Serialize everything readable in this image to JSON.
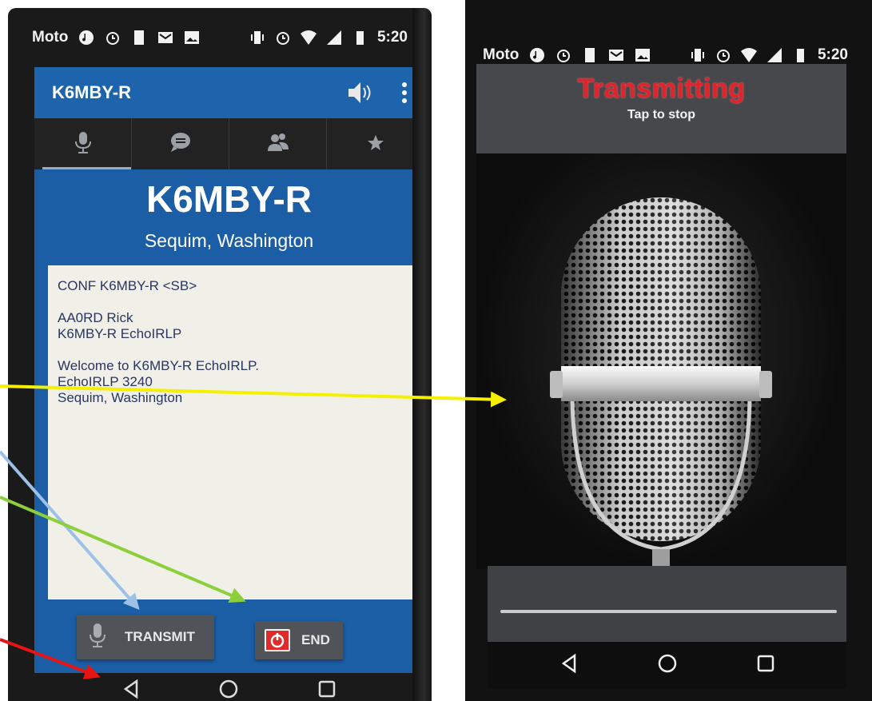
{
  "left_phone": {
    "status": {
      "carrier": "Moto",
      "time": "5:20"
    },
    "appbar": {
      "title": "K6MBY-R"
    },
    "tabs": [
      {
        "name": "microphone-icon",
        "active": true
      },
      {
        "name": "chat-icon",
        "active": false
      },
      {
        "name": "people-icon",
        "active": false
      },
      {
        "name": "star-icon",
        "active": false
      }
    ],
    "station": {
      "callsign": "K6MBY-R",
      "location": "Sequim, Washington"
    },
    "messages": [
      "CONF K6MBY-R <SB>",
      "",
      "AA0RD Rick",
      "K6MBY-R EchoIRLP",
      "",
      "Welcome to K6MBY-R EchoIRLP.",
      "EchoIRLP 3240",
      "Sequim, Washington"
    ],
    "buttons": {
      "transmit": "TRANSMIT",
      "end": "END"
    }
  },
  "right_phone": {
    "status": {
      "carrier": "Moto",
      "time": "5:20"
    },
    "transmitting": {
      "title": "Transmitting",
      "subtitle": "Tap to stop"
    }
  },
  "colors": {
    "appbar_blue": "#1d64ad",
    "content_blue": "#1b5ea6",
    "transmit_red": "#e0242c",
    "arrow_yellow": "#f5f000",
    "arrow_light_blue": "#9cc0e6",
    "arrow_green": "#8ccf3a",
    "arrow_red": "#e81414"
  }
}
